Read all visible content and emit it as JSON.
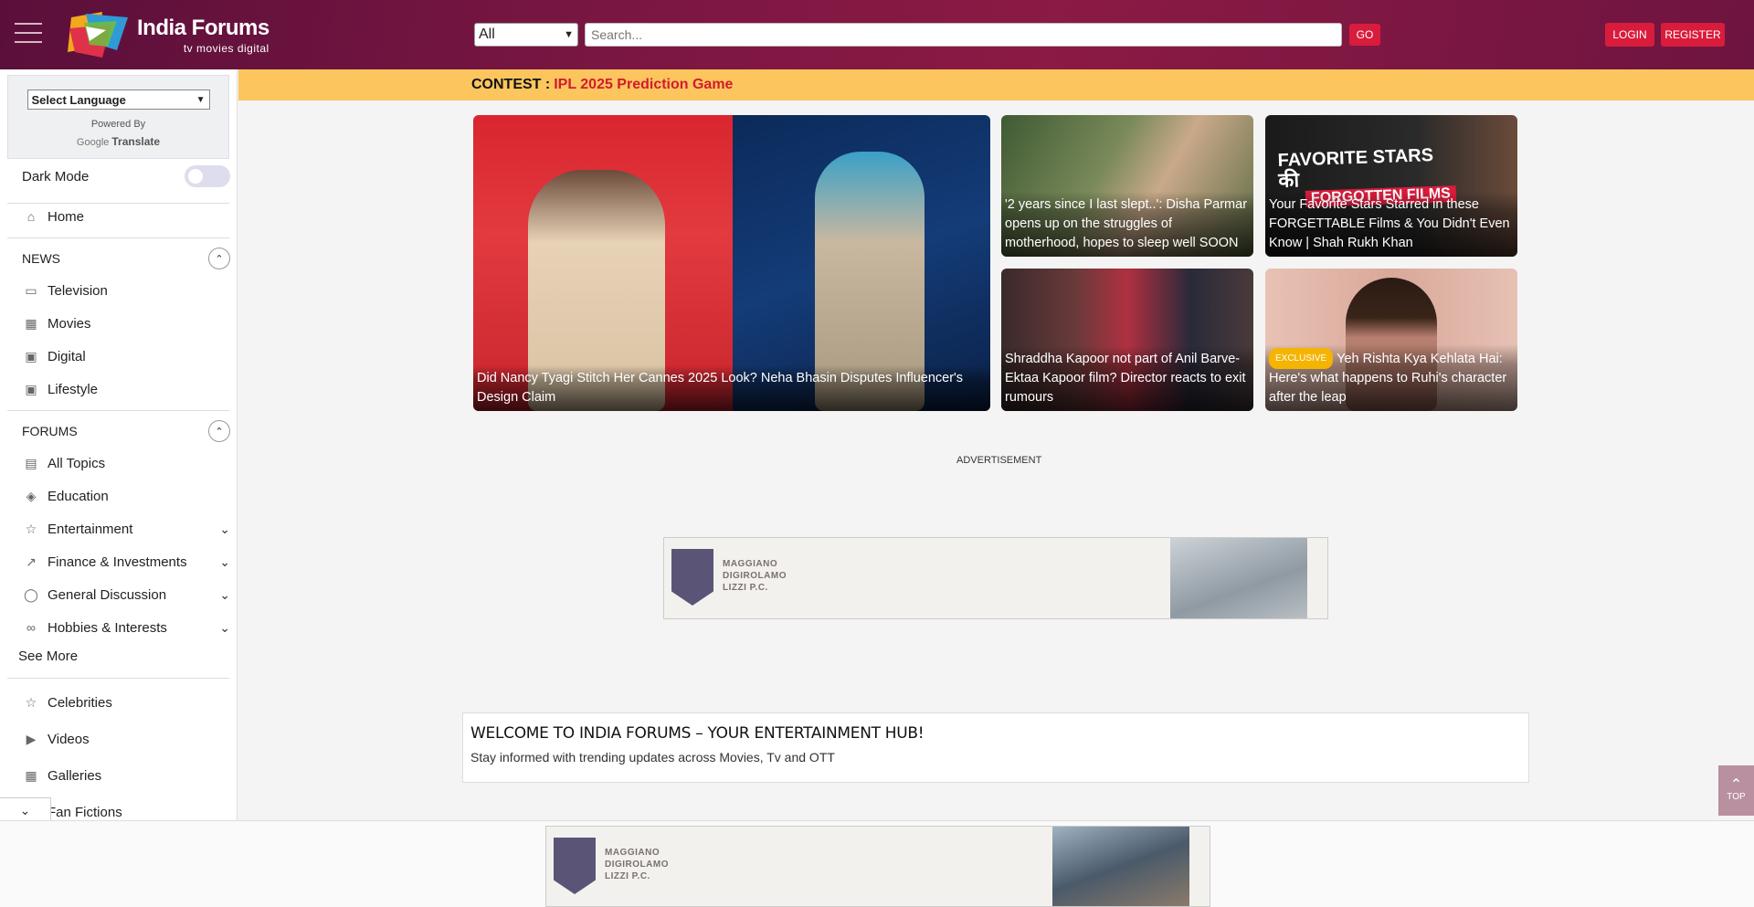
{
  "header": {
    "brand_title": "India Forums",
    "brand_sub": "tv  movies  digital",
    "search_scope": "All",
    "search_placeholder": "Search...",
    "go_label": "GO",
    "login_label": "LOGIN",
    "register_label": "REGISTER"
  },
  "sidebar": {
    "language_select": "Select Language",
    "powered_by": "Powered By",
    "google_label": "Google",
    "translate_label": "Translate",
    "dark_mode_label": "Dark Mode",
    "home_label": "Home",
    "news_heading": "NEWS",
    "news_items": [
      {
        "label": "Television",
        "icon": "tv-icon"
      },
      {
        "label": "Movies",
        "icon": "film-icon"
      },
      {
        "label": "Digital",
        "icon": "digital-icon"
      },
      {
        "label": "Lifestyle",
        "icon": "lifestyle-icon"
      }
    ],
    "forums_heading": "FORUMS",
    "forum_items": [
      {
        "label": "All Topics",
        "icon": "topics-icon"
      },
      {
        "label": "Education",
        "icon": "education-icon"
      },
      {
        "label": "Entertainment",
        "icon": "star-icon"
      },
      {
        "label": "Finance & Investments",
        "icon": "chart-icon"
      },
      {
        "label": "General Discussion",
        "icon": "chat-icon"
      },
      {
        "label": "Hobbies & Interests",
        "icon": "hobbies-icon"
      }
    ],
    "see_more": "See More",
    "extra_items": [
      {
        "label": "Celebrities",
        "icon": "star-icon"
      },
      {
        "label": "Videos",
        "icon": "video-icon"
      },
      {
        "label": "Galleries",
        "icon": "gallery-icon"
      },
      {
        "label": "Fan Fictions",
        "icon": "book-icon"
      }
    ]
  },
  "contest": {
    "label": "CONTEST :",
    "value": "IPL 2025 Prediction Game"
  },
  "featured": [
    {
      "title": "Did Nancy Tyagi Stitch Her Cannes 2025 Look? Neha Bhasin Disputes Influencer's Design Claim",
      "badge": ""
    },
    {
      "title": "'2 years since I last slept..': Disha Parmar opens up on the struggles of motherhood, hopes to sleep well SOON",
      "badge": ""
    },
    {
      "title": "Your Favorite Stars Starred in these FORGETTABLE Films & You Didn't Even Know | Shah Rukh Khan",
      "badge": ""
    },
    {
      "title": "Shraddha Kapoor not part of Anil Barve-Ektaa Kapoor film? Director reacts to exit rumours",
      "badge": ""
    },
    {
      "title": "Yeh Rishta Kya Kehlata Hai: Here's what happens to Ruhi's character after the leap",
      "badge": "EXCLUSIVE"
    }
  ],
  "thumb_text": {
    "fav_line1": "FAVORITE STARS",
    "fav_line2": "की",
    "fav_line3": "FORGOTTEN FILMS"
  },
  "ad": {
    "label": "ADVERTISEMENT",
    "brand_line1": "MAGGIANO",
    "brand_line2": "DIGIROLAMO",
    "brand_line3": "LIZZI P.C."
  },
  "welcome": {
    "title": "WELCOME TO INDIA FORUMS – YOUR ENTERTAINMENT HUB!",
    "subtitle": "Stay informed with trending updates across Movies, Tv and OTT"
  },
  "top_button": "TOP",
  "colors": {
    "accent": "#d91c3c",
    "contest_bg": "#fdc55e",
    "header": "#7a1642"
  }
}
